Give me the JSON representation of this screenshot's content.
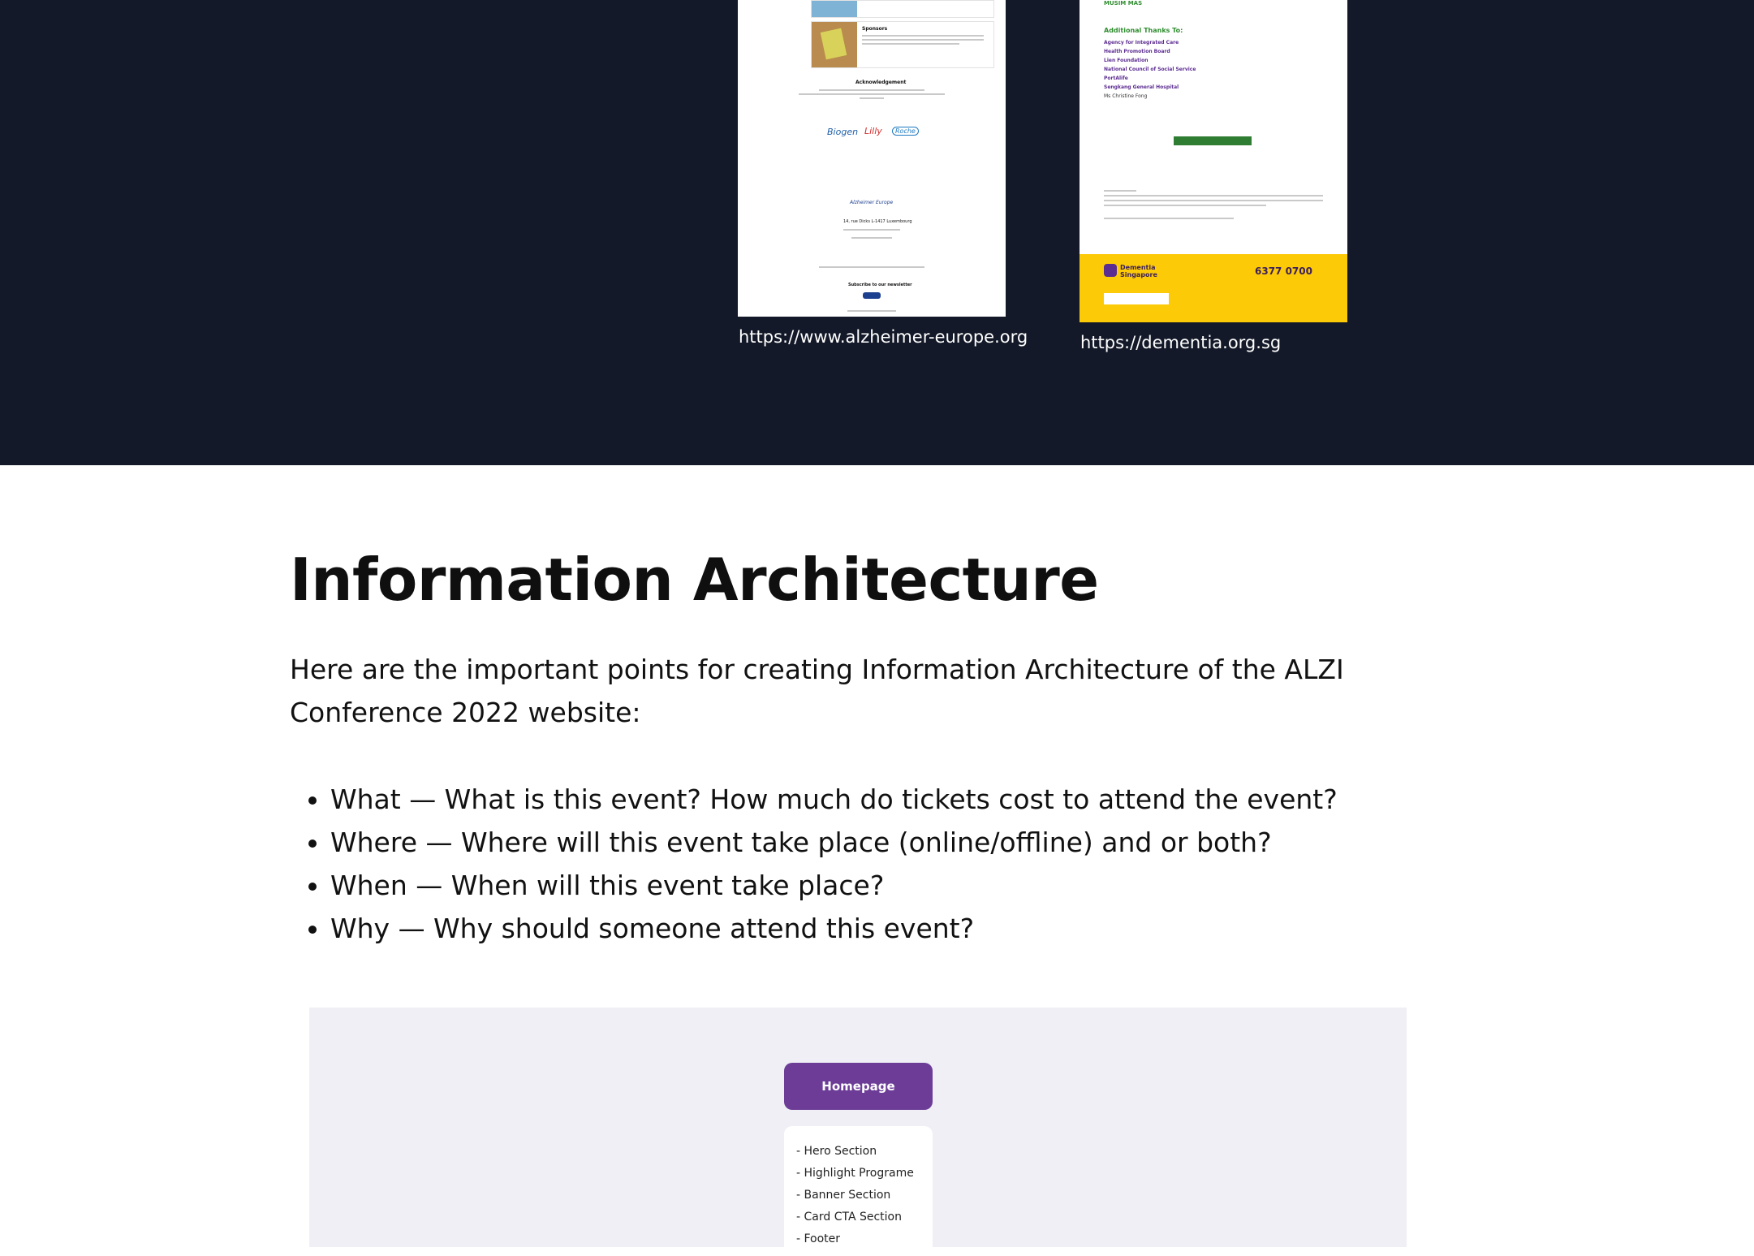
{
  "showcase": {
    "alz": {
      "caption": "https://www.alzheimer-europe.org",
      "sponsors_heading": "Sponsors",
      "ack_heading": "Acknowledgement",
      "logos": [
        "Biogen",
        "Lilly",
        "Roche"
      ],
      "footer_brand": "Alzheimer Europe",
      "address": "14, rue Dicks L-1417 Luxembourg",
      "subscribe": "Subscribe to our newsletter"
    },
    "dem": {
      "caption": "https://dementia.org.sg",
      "top_label": "MUSIM MAS",
      "thanks_heading": "Additional Thanks To:",
      "thanks": [
        "Agency for Integrated Care",
        "Health Promotion Board",
        "Lien Foundation",
        "National Council of Social Service",
        "PortAlife",
        "Sengkang General Hospital",
        "Ms Christine Fong"
      ],
      "brand": "Dementia Singapore",
      "phone": "6377 0700"
    }
  },
  "content": {
    "title": "Information Architecture",
    "intro": "Here are the important points for creating Information Architecture of the ALZI Conference 2022 website:",
    "points": [
      "What — What is this event? How much do tickets cost to attend the event?",
      "Where — Where will this event take place (online/offline) and or both?",
      "When — When will this event take place?",
      "Why — Why should someone attend this event?"
    ]
  },
  "diagram": {
    "root": "Homepage",
    "sections": [
      "- Hero Section",
      "- Highlight Programe",
      "- Banner Section",
      "- Card CTA Section",
      "- Footer"
    ]
  }
}
